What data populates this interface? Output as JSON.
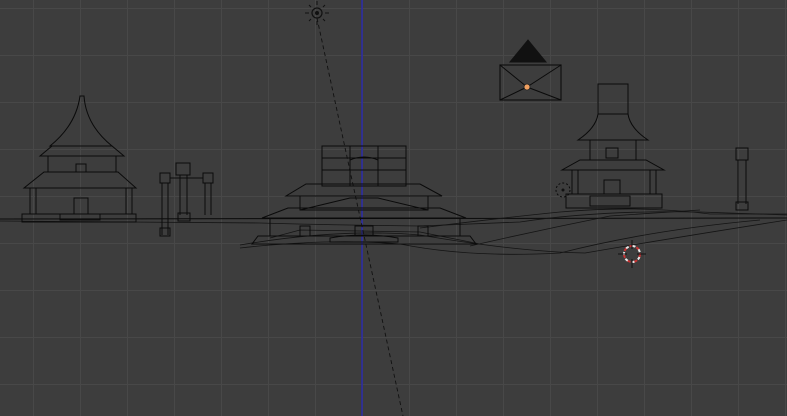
{
  "app": {
    "name": "3D Viewport"
  },
  "viewport": {
    "background_color": "#3d3d3d",
    "grid_color": "#484848",
    "axis_color": "#2a2aa8",
    "wire_color": "#0a0a0a",
    "selected_origin_color": "#f0a060",
    "cursor_color": "#c83232"
  },
  "objects": [
    {
      "name": "sun-lamp",
      "icon": "sun-icon"
    },
    {
      "name": "camera",
      "icon": "camera-icon"
    },
    {
      "name": "left-pagoda"
    },
    {
      "name": "torii-gate"
    },
    {
      "name": "central-temple"
    },
    {
      "name": "right-tower"
    },
    {
      "name": "lantern-post"
    },
    {
      "name": "terrain"
    }
  ],
  "cursor": {
    "icon": "3d-cursor-icon"
  }
}
